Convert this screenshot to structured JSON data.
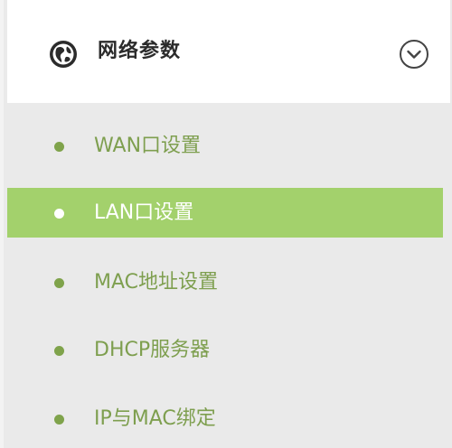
{
  "section": {
    "title": "网络参数",
    "icon": "globe-icon",
    "toggle_icon": "chevron-down-icon"
  },
  "menu": {
    "items": [
      {
        "label": "WAN口设置",
        "active": false
      },
      {
        "label": "LAN口设置",
        "active": true
      },
      {
        "label": "MAC地址设置",
        "active": false
      },
      {
        "label": "DHCP服务器",
        "active": false
      },
      {
        "label": "IP与MAC绑定",
        "active": false
      }
    ]
  },
  "colors": {
    "accent": "#a3d16c",
    "text_green": "#7e9f4f",
    "panel_bg": "#eaeaea",
    "header_bg": "#ffffff"
  }
}
